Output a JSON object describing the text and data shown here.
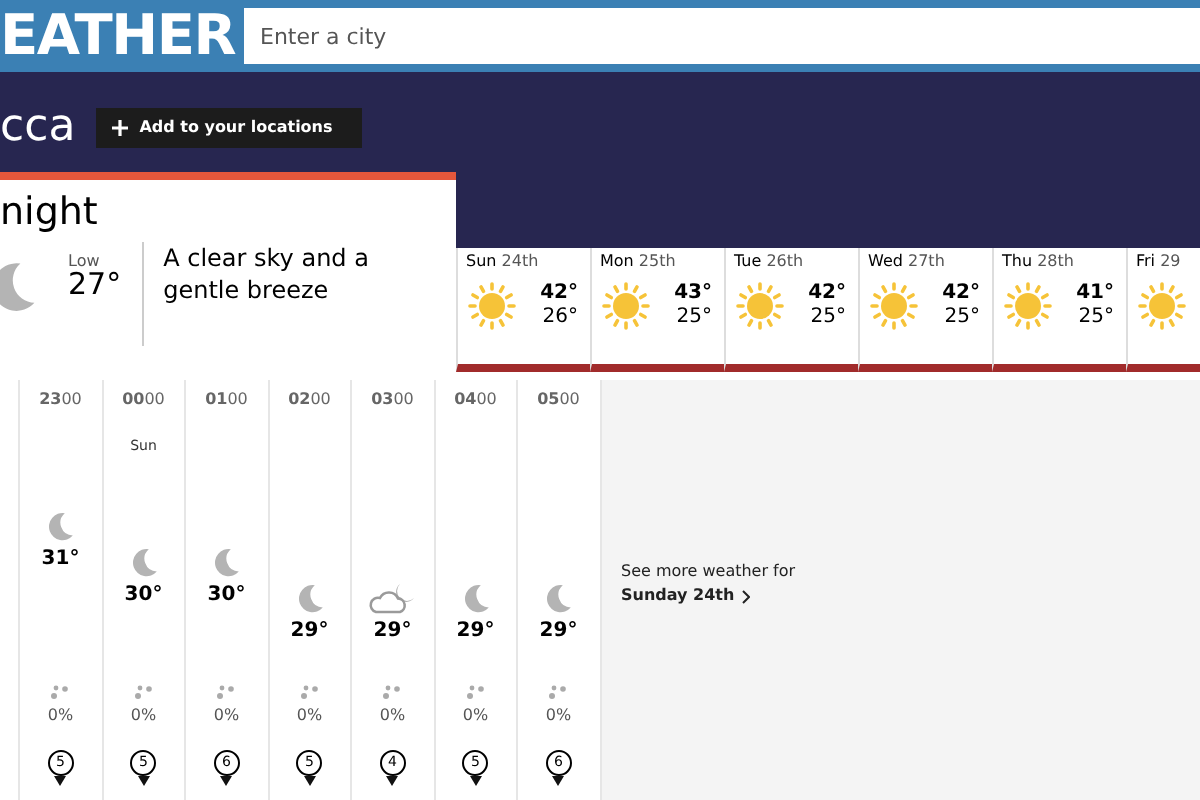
{
  "header": {
    "title": "EATHER",
    "search": {
      "placeholder": "Enter a city"
    }
  },
  "location": {
    "name": "cca",
    "add_button": "Add to your locations"
  },
  "tonight": {
    "title": "night",
    "low_label": "Low",
    "low": "27°",
    "description": "A clear sky and a gentle breeze"
  },
  "days": [
    {
      "day": "Sun",
      "date": "24th",
      "high": "42°",
      "low": "26°",
      "selected": false
    },
    {
      "day": "Mon",
      "date": "25th",
      "high": "43°",
      "low": "25°",
      "selected": false
    },
    {
      "day": "Tue",
      "date": "26th",
      "high": "42°",
      "low": "25°",
      "selected": false
    },
    {
      "day": "Wed",
      "date": "27th",
      "high": "42°",
      "low": "25°",
      "selected": false
    },
    {
      "day": "Thu",
      "date": "28th",
      "high": "41°",
      "low": "25°",
      "selected": false
    },
    {
      "day": "Fri",
      "date": "29",
      "selected": false
    }
  ],
  "hours": [
    {
      "time": "**23**00",
      "kind": "moon",
      "temp": "31°",
      "rain": "0%",
      "wind": "5"
    },
    {
      "time": "**00**00",
      "day": "Sun",
      "kind": "moon",
      "temp": "30°",
      "rain": "0%",
      "wind": "5"
    },
    {
      "time": "**01**00",
      "kind": "moon",
      "temp": "30°",
      "rain": "0%",
      "wind": "6"
    },
    {
      "time": "**02**00",
      "kind": "moon",
      "temp": "29°",
      "rain": "0%",
      "wind": "5"
    },
    {
      "time": "**03**00",
      "kind": "cloud-moon",
      "temp": "29°",
      "rain": "0%",
      "wind": "4"
    },
    {
      "time": "**04**00",
      "kind": "moon",
      "temp": "29°",
      "rain": "0%",
      "wind": "5"
    },
    {
      "time": "**05**00",
      "kind": "moon",
      "temp": "29°",
      "rain": "0%",
      "wind": "6"
    }
  ],
  "more": {
    "text": "See more weather for",
    "link": "Sunday 24th"
  }
}
